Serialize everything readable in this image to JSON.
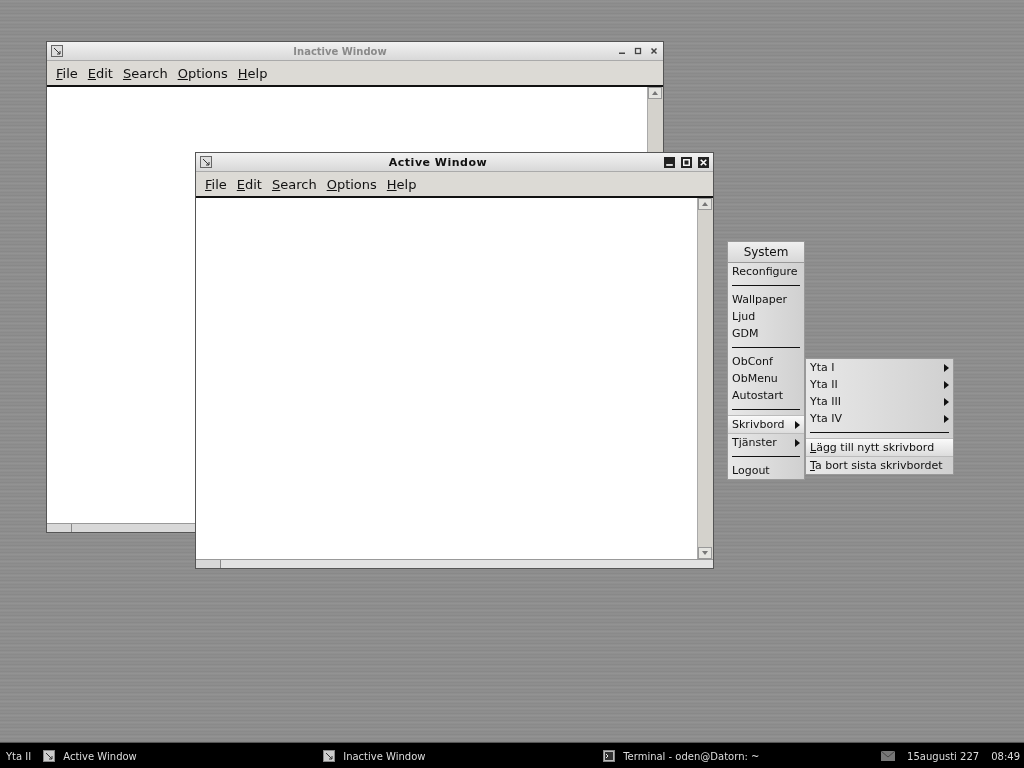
{
  "windows": [
    {
      "title": "Inactive Window",
      "active": false,
      "menu": [
        "File",
        "Edit",
        "Search",
        "Options",
        "Help"
      ]
    },
    {
      "title": "Active Window",
      "active": true,
      "menu": [
        "File",
        "Edit",
        "Search",
        "Options",
        "Help"
      ]
    }
  ],
  "root_menu": {
    "title": "System",
    "items": [
      {
        "kind": "item",
        "label": "Reconfigure",
        "selected": false
      },
      {
        "kind": "separator"
      },
      {
        "kind": "item",
        "label": "Wallpaper",
        "selected": false
      },
      {
        "kind": "item",
        "label": "Ljud",
        "selected": false
      },
      {
        "kind": "item",
        "label": "GDM",
        "selected": false
      },
      {
        "kind": "separator"
      },
      {
        "kind": "item",
        "label": "ObConf",
        "selected": false
      },
      {
        "kind": "item",
        "label": "ObMenu",
        "selected": false
      },
      {
        "kind": "item",
        "label": "Autostart",
        "selected": false
      },
      {
        "kind": "separator"
      },
      {
        "kind": "submenu",
        "label": "Skrivbord",
        "selected": true
      },
      {
        "kind": "submenu",
        "label": "Tjänster",
        "selected": false
      },
      {
        "kind": "separator"
      },
      {
        "kind": "item",
        "label": "Logout",
        "selected": false
      }
    ]
  },
  "submenu": {
    "items": [
      {
        "kind": "submenu",
        "label": "Yta I",
        "selected": false
      },
      {
        "kind": "submenu",
        "label": "Yta II",
        "selected": false
      },
      {
        "kind": "submenu",
        "label": "Yta III",
        "selected": false
      },
      {
        "kind": "submenu",
        "label": "Yta IV",
        "selected": false
      },
      {
        "kind": "separator"
      },
      {
        "kind": "mnemonic",
        "label": "Lägg till nytt skrivbord",
        "selected": true
      },
      {
        "kind": "mnemonic",
        "label": "Ta bort sista skrivbordet",
        "selected": false
      }
    ]
  },
  "taskbar": {
    "desktop": "Yta II",
    "tasks": [
      {
        "kind": "window",
        "label": "Active Window"
      },
      {
        "kind": "window",
        "label": "Inactive Window"
      },
      {
        "kind": "terminal",
        "label": "Terminal - oden@Datorn: ~"
      }
    ],
    "date": "15augusti 227",
    "time": "08:49"
  }
}
